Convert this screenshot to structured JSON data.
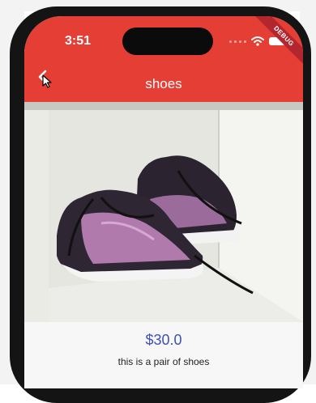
{
  "status_bar": {
    "time": "3:51",
    "debug_label": "DEBUG"
  },
  "app_bar": {
    "title": "shoes",
    "back_icon": "chevron-left-icon",
    "color": "#e53f35"
  },
  "product": {
    "image_alt": "pair of purple and black running shoes",
    "price": "$30.0",
    "description": "this is a pair of shoes",
    "price_color": "#3f51b5"
  }
}
